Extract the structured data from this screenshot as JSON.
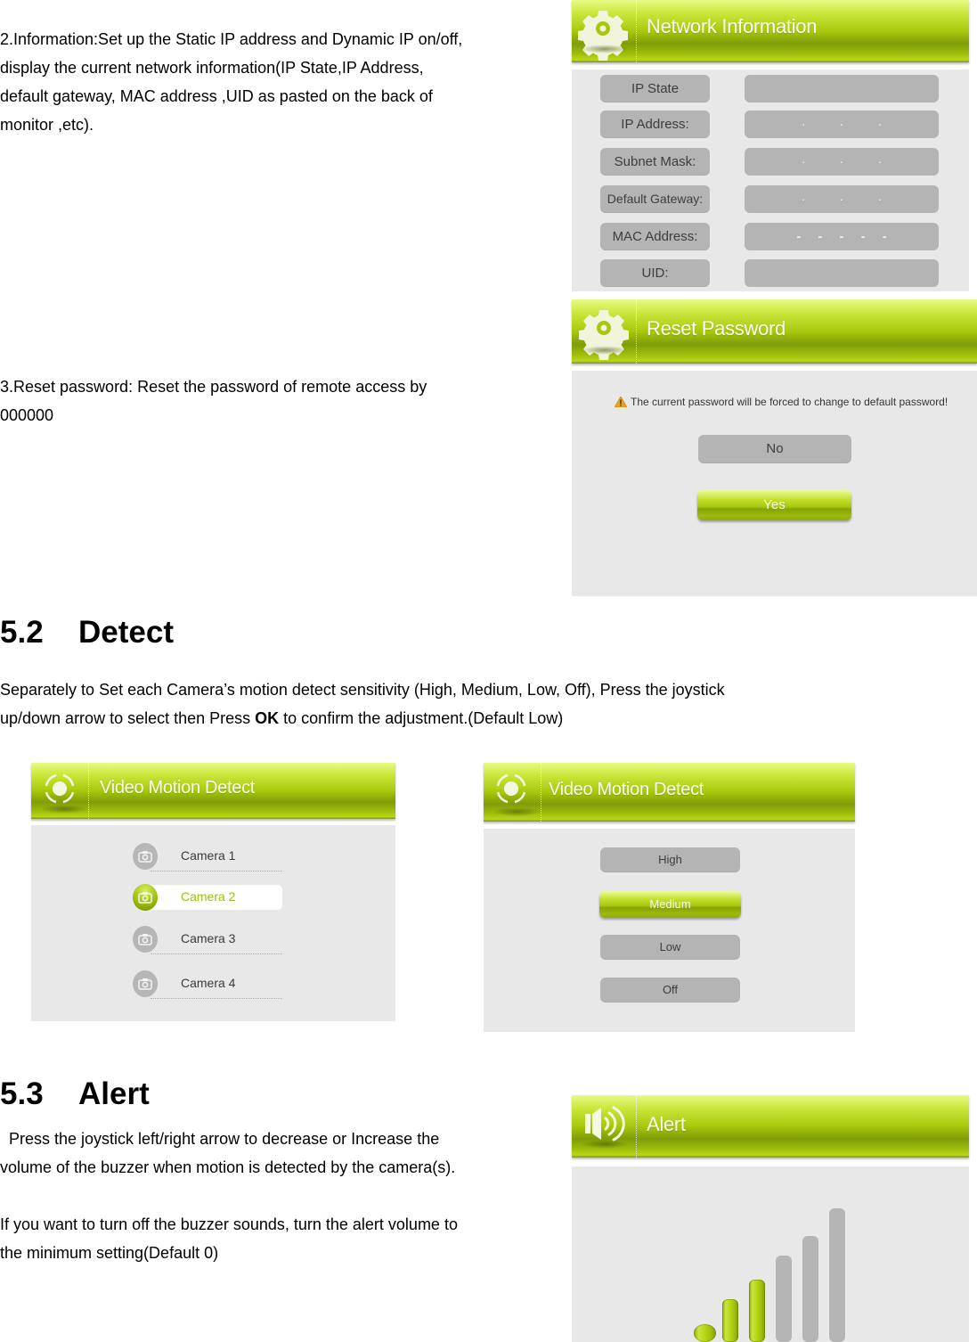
{
  "section_info": {
    "information_text_lines": [
      "2.Information:Set up the Static IP address and Dynamic IP on/off,",
      "display the current network information(IP State,IP Address,",
      "default gateway, MAC address ,UID as pasted on the back of",
      "monitor ,etc)."
    ],
    "reset_text_lines": [
      "3.Reset password: Reset the password of remote access by",
      "000000"
    ]
  },
  "network_panel": {
    "title": "Network Information",
    "icon": "gear-icon",
    "rows": [
      {
        "label": "IP State",
        "value": ""
      },
      {
        "label": "IP Address:",
        "value": ".          .          ."
      },
      {
        "label": "Subnet Mask:",
        "value": ".          .          ."
      },
      {
        "label": "Default Gateway:",
        "value": ".          .          ."
      },
      {
        "label": "MAC Address:",
        "value": "-     -     -     -     -"
      },
      {
        "label": "UID:",
        "value": ""
      }
    ]
  },
  "reset_panel": {
    "title": "Reset Password",
    "icon": "gear-icon",
    "warning": "The current password will be forced to change to default password!",
    "buttons": {
      "no": "No",
      "yes": "Yes"
    },
    "selected": "Yes"
  },
  "detect_section": {
    "heading_number": "5.2",
    "heading_title": "Detect",
    "text_line1": "Separately to Set each Camera’s motion detect sensitivity (High, Medium, Low, Off), Press the joystick",
    "text_line2_before": "up/down arrow to select then Press ",
    "text_line2_bold": "OK",
    "text_line2_after": " to confirm the adjustment.(Default Low)"
  },
  "motion_camera_panel": {
    "title": "Video Motion Detect",
    "icon": "motion-target-icon",
    "cameras": [
      "Camera 1",
      "Camera 2",
      "Camera 3",
      "Camera 4"
    ],
    "selected_index": 1
  },
  "motion_sensitivity_panel": {
    "title": "Video Motion Detect",
    "icon": "motion-target-icon",
    "options": [
      "High",
      "Medium",
      "Low",
      "Off"
    ],
    "selected": "Medium"
  },
  "alert_section": {
    "heading_number": "5.3",
    "heading_title": "Alert",
    "text_lines": [
      "  Press the joystick left/right arrow to decrease or Increase the",
      "volume of the buzzer when motion is detected by the camera(s)."
    ],
    "text_lines2": [
      "If you want to turn off the buzzer sounds, turn the alert volume to",
      "the minimum setting(Default 0)"
    ]
  },
  "alert_panel": {
    "title": "Alert",
    "icon": "speaker-icon",
    "volume_levels_total": 6,
    "volume_level_active": 3
  },
  "colors": {
    "accent_green": "#a8c80d",
    "panel_bg": "#e8e8e8",
    "button_gray": "#b4b4b4",
    "selected_text_green": "#9cbc12"
  }
}
